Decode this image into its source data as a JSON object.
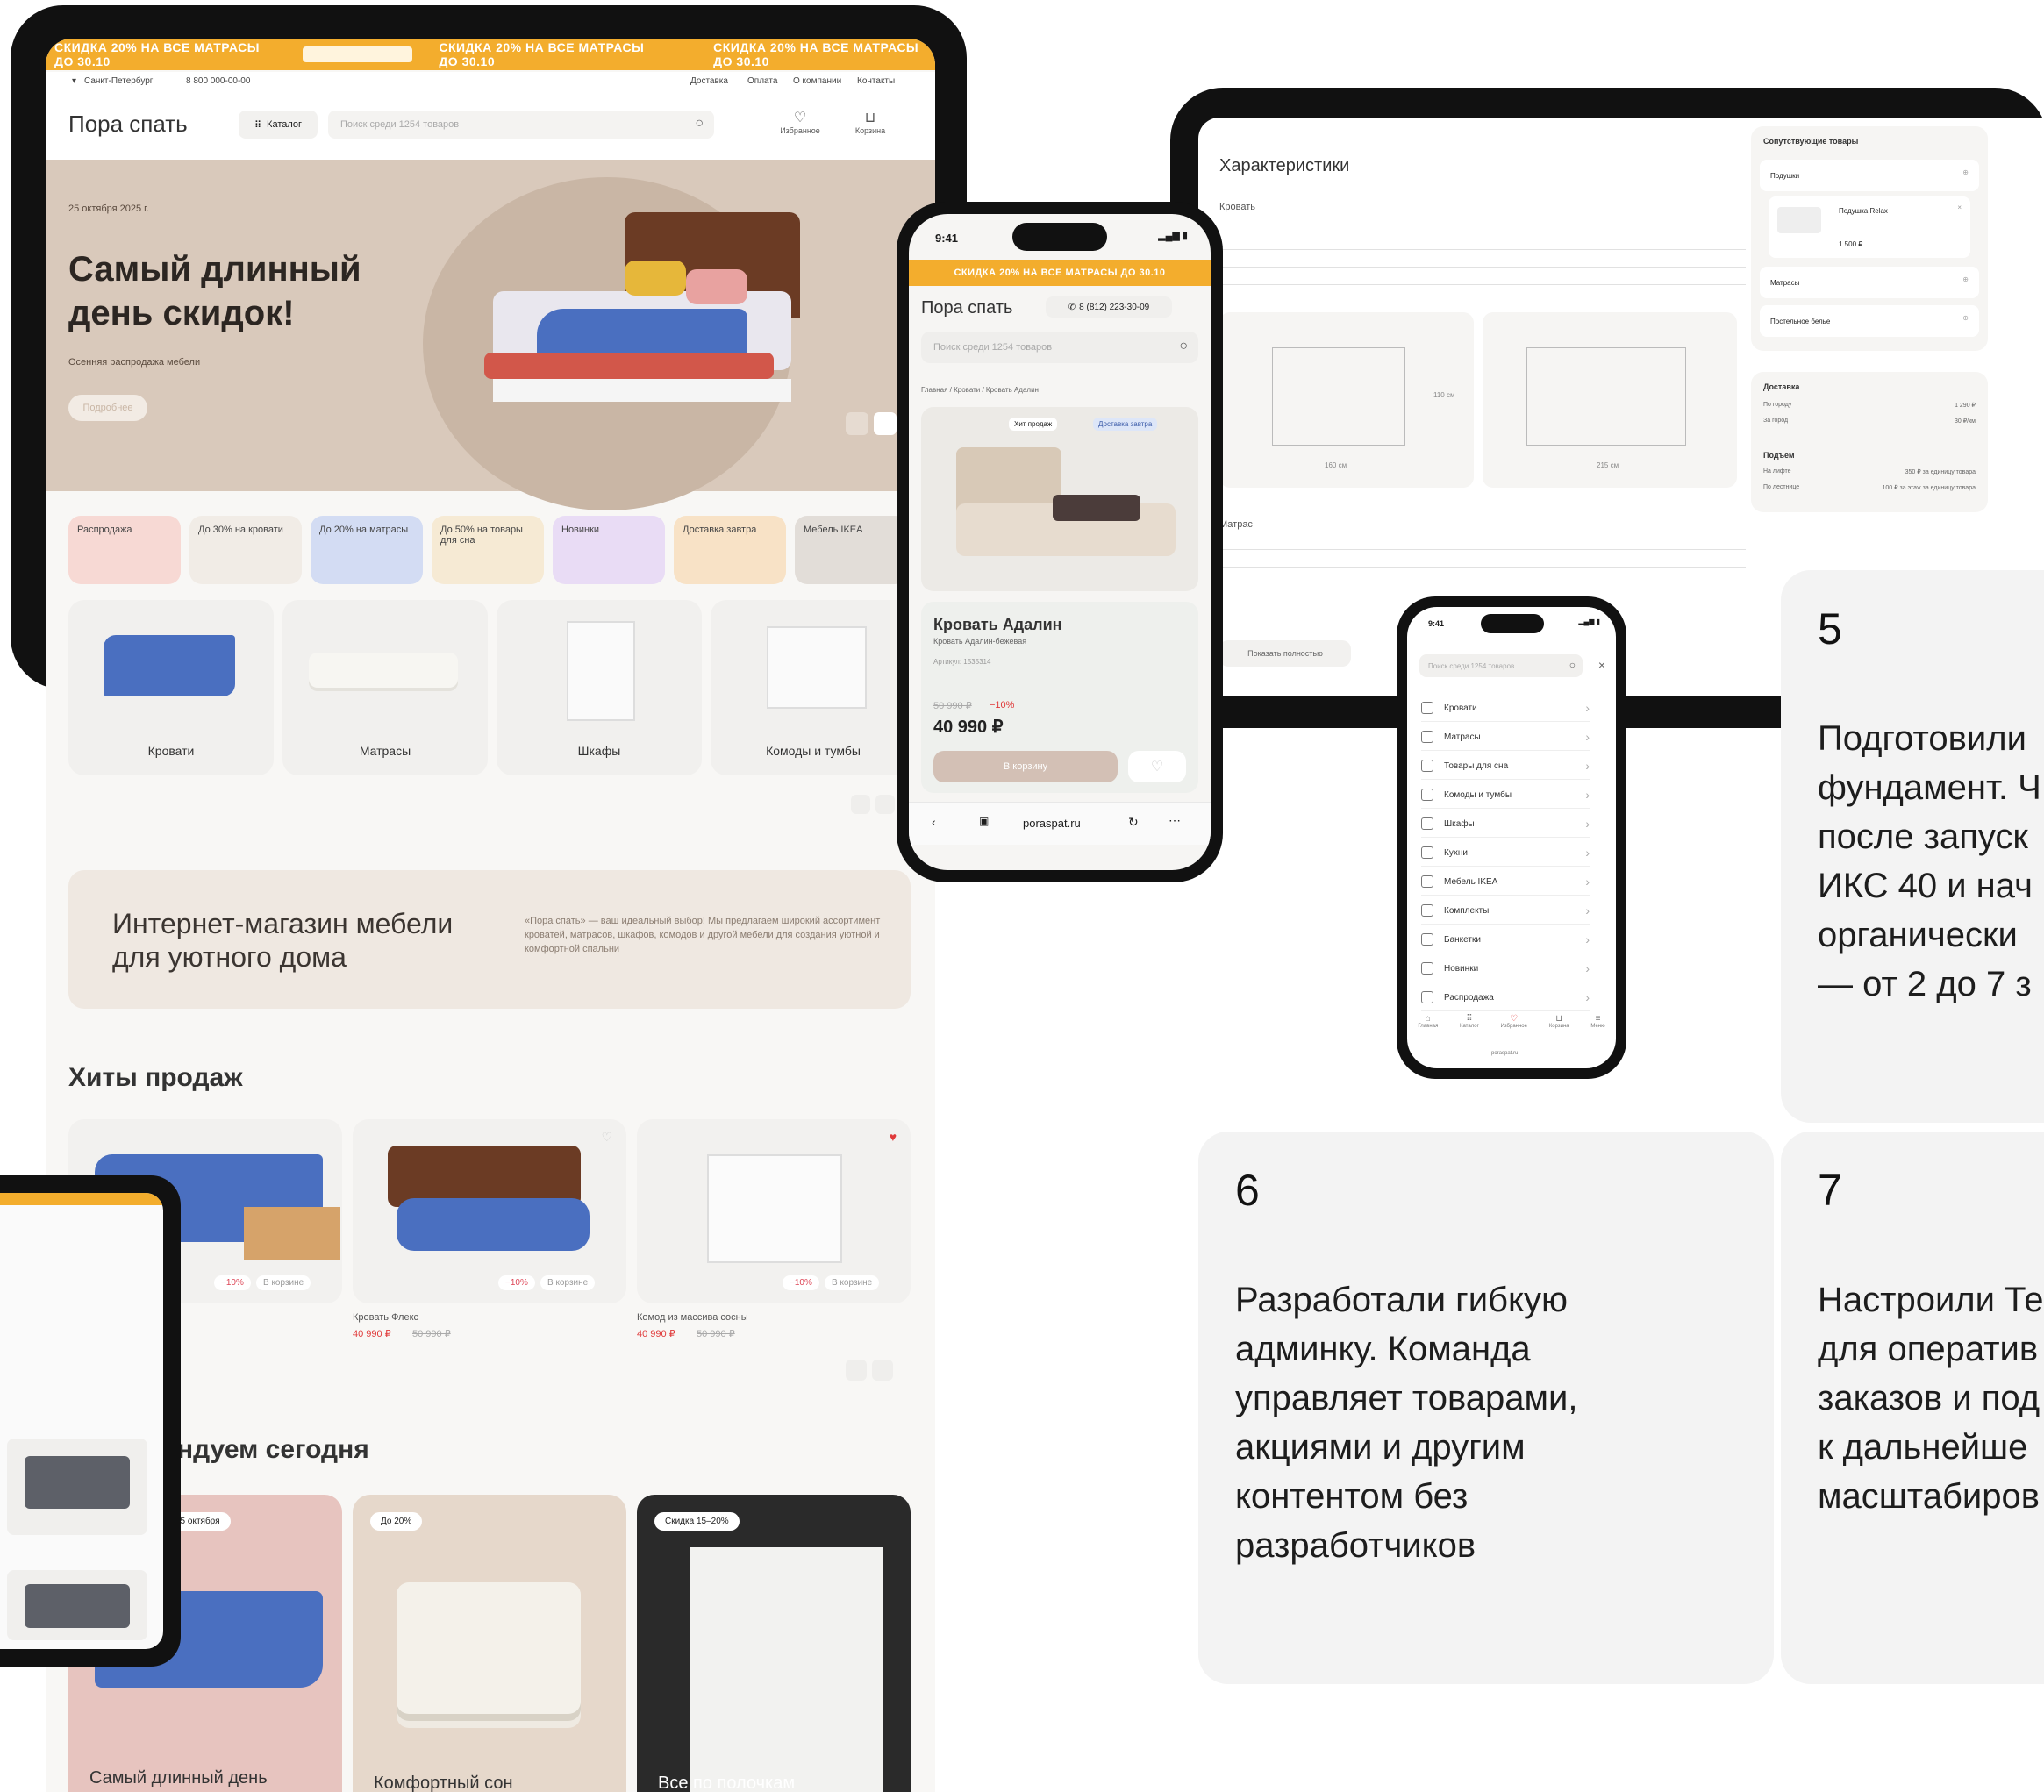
{
  "tablet_main": {
    "banner_text": "СКИДКА 20% НА ВСЕ МАТРАСЫ ДО 30.10",
    "city": "Санкт-Петербург",
    "phone": "8 800 000-00-00",
    "top_links": [
      "Доставка",
      "Оплата",
      "О компании",
      "Контакты"
    ],
    "logo": "Пора спать",
    "catalog_label": "Каталог",
    "search_placeholder": "Поиск среди 1254 товаров",
    "favorites_label": "Избранное",
    "cart_label": "Корзина",
    "hero_date": "25 октября 2025 г.",
    "hero_title_1": "Самый длинный",
    "hero_title_2": "день скидок!",
    "hero_subtitle": "Осенняя распродажа мебели",
    "hero_button": "Подробнее",
    "promo_tiles": [
      "Распродажа",
      "До 30% на кровати",
      "До 20% на матрасы",
      "До 50% на товары для сна",
      "Новинки",
      "Доставка завтра",
      "Мебель IKEA"
    ],
    "categories": [
      "Кровати",
      "Матрасы",
      "Шкафы",
      "Комоды и тумбы"
    ],
    "about_title_1": "Интернет-магазин мебели",
    "about_title_2": "для уютного дома",
    "about_text": "«Пора спать» — ваш идеальный выбор! Мы предлагаем широкий ассортимент кроватей, матрасов, шкафов, комодов и другой мебели для создания уютной и комфортной спальни",
    "hits_title": "Хиты продаж",
    "products": [
      {
        "name": "",
        "price": "",
        "old_price": "",
        "discount": "−10%"
      },
      {
        "name": "Кровать Флекс",
        "price": "40 990 ₽",
        "old_price": "50 990 ₽",
        "discount": "−10%"
      },
      {
        "name": "Комод из массива сосны",
        "price": "40 990 ₽",
        "old_price": "50 990 ₽",
        "discount": "−10%"
      }
    ],
    "in_cart_label": "В корзине",
    "recommend_title": "ндуем сегодня",
    "offers": [
      {
        "badge": "25 октября",
        "title": "Самый длинный день"
      },
      {
        "badge": "До 20%",
        "title": "Комфортный сон"
      },
      {
        "badge": "Скидка 15–20%",
        "title": "Все по полочкам"
      }
    ]
  },
  "phone_product": {
    "time": "9:41",
    "banner_text": "СКИДКА 20% НА ВСЕ МАТРАСЫ ДО 30.10",
    "logo": "Пора спать",
    "phone": "8 (812) 223-30-09",
    "search_placeholder": "Поиск среди 1254 товаров",
    "breadcrumb": "Главная / Кровати / Кровать Адалин",
    "badge_hit": "Хит продаж",
    "badge_delivery": "Доставка завтра",
    "product_title": "Кровать Адалин",
    "product_subtitle": "Кровать Адалин-бежевая",
    "article": "Артикул: 1535314",
    "old_price": "50 990 ₽",
    "discount": "−10%",
    "price": "40 990 ₽",
    "cart_button": "В корзину",
    "url": "poraspat.ru"
  },
  "tablet_specs": {
    "title": "Характеристики",
    "section_bed": "Кровать",
    "section_mattress": "Матрас",
    "related_title": "Сопутствующие товары",
    "related_items": [
      "Подушки",
      "Матрасы",
      "Постельное белье"
    ],
    "pillow_name": "Подушка Relax",
    "pillow_price": "1 500 ₽",
    "delivery_title": "Доставка",
    "delivery_rows": [
      {
        "label": "По городу",
        "value": "1 290 ₽"
      },
      {
        "label": "За город",
        "value": "30 ₽/км"
      }
    ],
    "lift_title": "Подъем",
    "lift_rows": [
      {
        "label": "На лифте",
        "value": "350 ₽ за единицу товара"
      },
      {
        "label": "По лестнице",
        "value": "100 ₽ за этаж за единицу товара"
      }
    ],
    "show_all_button": "Показать полностью",
    "dim_width": "160 см",
    "dim_height": "110 см",
    "dim_length": "215 см"
  },
  "phone_menu": {
    "time": "9:41",
    "search_placeholder": "Поиск среди 1254 товаров",
    "items": [
      "Кровати",
      "Матрасы",
      "Товары для сна",
      "Комоды и тумбы",
      "Шкафы",
      "Кухни",
      "Мебель IKEA",
      "Комплекты",
      "Банкетки",
      "Новинки",
      "Распродажа"
    ],
    "tabbar": [
      "Главная",
      "Каталог",
      "Избранное",
      "Корзина",
      "Меню"
    ],
    "url": "poraspat.ru"
  },
  "steps": [
    {
      "number": "5",
      "text_lines": [
        "Подготовили",
        "фундамент. Ч",
        "после запуск",
        "ИКС 40 и нач",
        "органически",
        "— от 2 до 7 з"
      ]
    },
    {
      "number": "6",
      "text_lines": [
        "Разработали гибкую",
        "админку. Команда",
        "управляет товарами,",
        "акциями и другим",
        "контентом без",
        "разработчиков"
      ]
    },
    {
      "number": "7",
      "text_lines": [
        "Настроили Те",
        "для оператив",
        "заказов и под",
        "к дальнейше",
        "масштабиров"
      ]
    }
  ],
  "colors": {
    "accent": "#f3ad2d",
    "hero_bg": "#d9c9bb",
    "card_bg": "#f3f3f3",
    "sale_red": "#e03a3a"
  }
}
